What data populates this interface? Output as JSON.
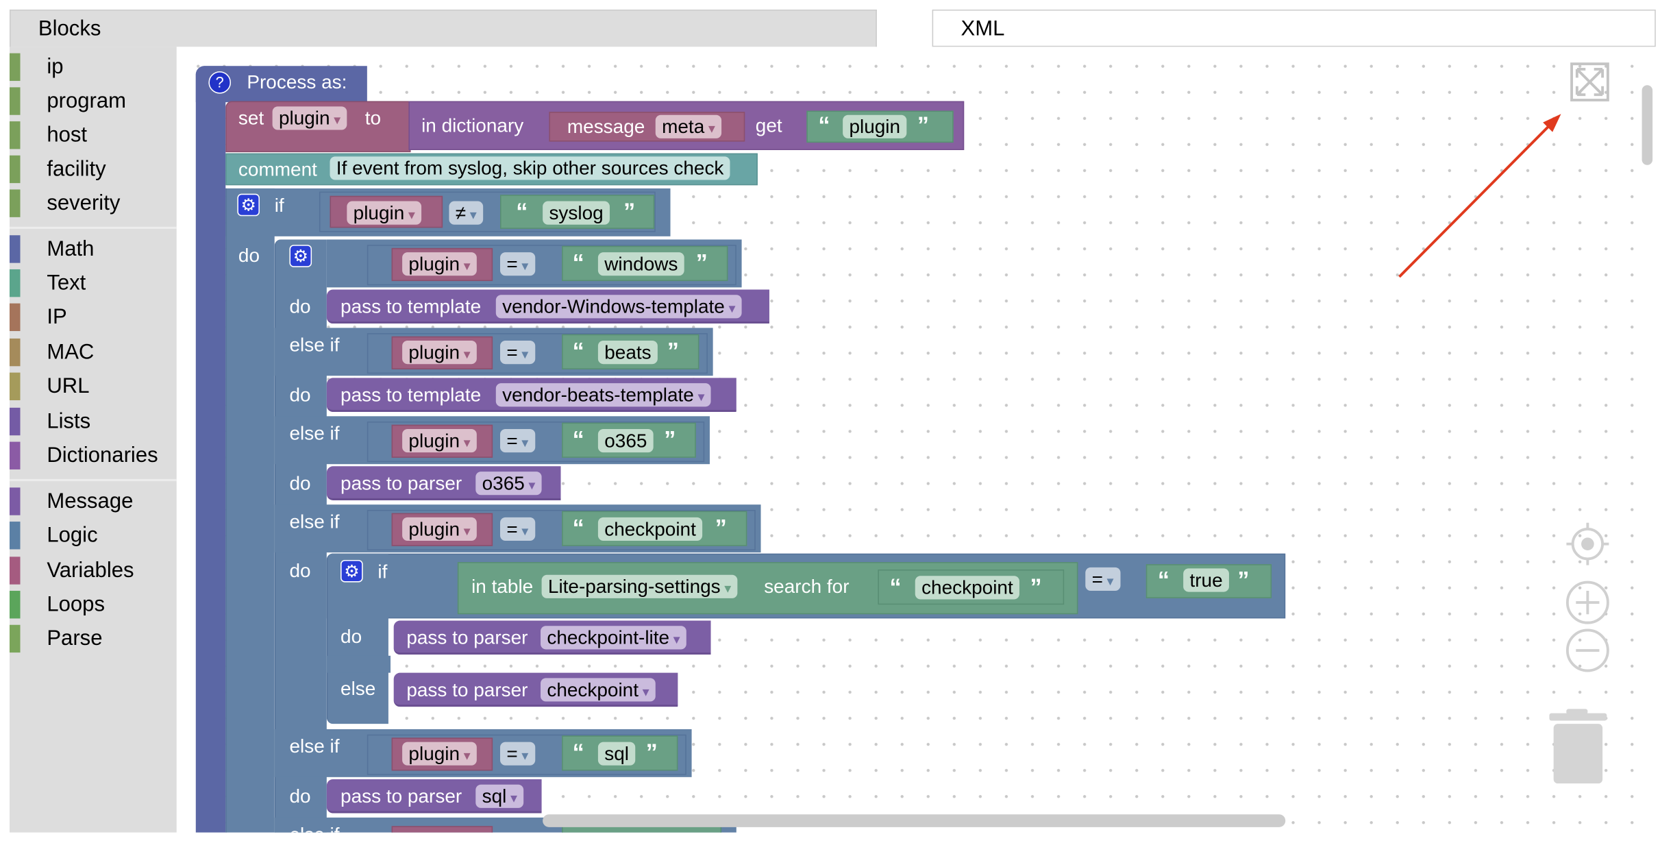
{
  "tabs": {
    "blocks": "Blocks",
    "xml": "XML"
  },
  "sidebar": {
    "categories": [
      {
        "label": "ip",
        "color": "#7ba05b"
      },
      {
        "label": "program",
        "color": "#7ba05b"
      },
      {
        "label": "host",
        "color": "#7ba05b"
      },
      {
        "label": "facility",
        "color": "#7ba05b"
      },
      {
        "label": "severity",
        "color": "#7ba05b"
      },
      {
        "label": "Math",
        "color": "#5b67a5"
      },
      {
        "label": "Text",
        "color": "#5ba58c"
      },
      {
        "label": "IP",
        "color": "#a5745b"
      },
      {
        "label": "MAC",
        "color": "#a58b5b"
      },
      {
        "label": "URL",
        "color": "#a59b5b"
      },
      {
        "label": "Lists",
        "color": "#745ba5"
      },
      {
        "label": "Dictionaries",
        "color": "#8b5ba5"
      },
      {
        "label": "Message",
        "color": "#7c5ba5"
      },
      {
        "label": "Logic",
        "color": "#5b80a5"
      },
      {
        "label": "Variables",
        "color": "#a55b80"
      },
      {
        "label": "Loops",
        "color": "#5ba55b"
      },
      {
        "label": "Parse",
        "color": "#7ba55b"
      }
    ]
  },
  "blocks": {
    "process": {
      "help": "?",
      "label": "Process as:"
    },
    "set": {
      "label": "set",
      "var": "plugin",
      "to": "to"
    },
    "dict": {
      "label": "in dictionary",
      "message": "message",
      "field": "meta",
      "get": "get",
      "key": "plugin"
    },
    "comment": {
      "label": "comment",
      "text": "If event from syslog, skip other sources check"
    },
    "if1": {
      "if": "if",
      "var": "plugin",
      "op": "≠",
      "value": "syslog",
      "do": "do"
    },
    "quotes": {
      "open": "“",
      "close": "”"
    },
    "chain": {
      "if": "if",
      "else_if": "else if",
      "do": "do",
      "else": "else",
      "rows": [
        {
          "var": "plugin",
          "op": "=",
          "value": "windows",
          "action": "pass to template",
          "target": "vendor-Windows-template"
        },
        {
          "var": "plugin",
          "op": "=",
          "value": "beats",
          "action": "pass to template",
          "target": "vendor-beats-template"
        },
        {
          "var": "plugin",
          "op": "=",
          "value": "o365",
          "action": "pass to parser",
          "target": "o365"
        },
        {
          "var": "plugin",
          "op": "=",
          "value": "checkpoint"
        },
        {
          "var": "plugin",
          "op": "=",
          "value": "sql",
          "action": "pass to parser",
          "target": "sql"
        }
      ]
    },
    "cp": {
      "if": "if",
      "in_table": "in table",
      "table": "Lite-parsing-settings",
      "search_for": "search for",
      "search": "checkpoint",
      "op": "=",
      "value": "true",
      "do": "do",
      "else": "else",
      "do_action": "pass to parser",
      "do_target": "checkpoint-lite",
      "else_action": "pass to parser",
      "else_target": "checkpoint"
    }
  },
  "controls": {
    "icons": [
      "fullscreen-icon",
      "recenter-icon",
      "zoom-in-icon",
      "zoom-out-icon",
      "trash-icon"
    ]
  },
  "annotation": {
    "color": "#e03a1e"
  }
}
